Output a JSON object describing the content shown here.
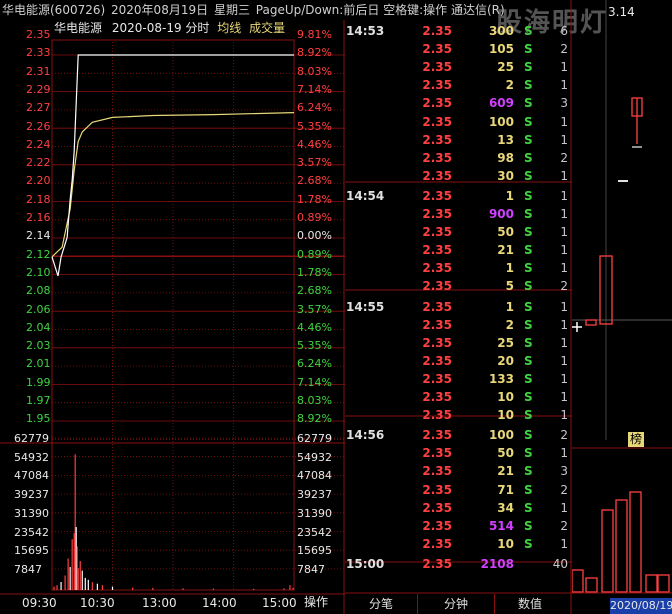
{
  "title_bar": {
    "stock": "华电能源(600726)",
    "date": "2020年08月19日",
    "weekday": "星期三",
    "hint": "PageUp/Down:前后日 空格键:操作 通达信(R)"
  },
  "watermark": "股海明灯",
  "chart_header": {
    "name": "华电能源",
    "date": "2020-08-19",
    "mode": "分时",
    "avg_label": "均线",
    "vol_label": "成交量"
  },
  "price_axis": {
    "left": [
      "2.35",
      "2.33",
      "2.31",
      "2.29",
      "2.27",
      "2.26",
      "2.24",
      "2.22",
      "2.20",
      "2.18",
      "2.16",
      "2.14",
      "2.12",
      "2.10",
      "2.08",
      "2.06",
      "2.04",
      "2.03",
      "2.01",
      "1.99",
      "1.97",
      "1.95"
    ],
    "right": [
      "9.81%",
      "8.92%",
      "8.03%",
      "7.14%",
      "6.24%",
      "5.35%",
      "4.46%",
      "3.57%",
      "2.68%",
      "1.78%",
      "0.89%",
      "0.00%",
      "0.89%",
      "1.78%",
      "2.68%",
      "3.57%",
      "4.46%",
      "5.35%",
      "6.24%",
      "7.14%",
      "8.03%",
      "8.92%"
    ]
  },
  "volume_axis": [
    "62779",
    "54932",
    "47084",
    "39237",
    "31390",
    "23542",
    "15695",
    "7847"
  ],
  "time_axis": [
    "09:30",
    "10:30",
    "13:00",
    "14:00",
    "15:00"
  ],
  "operate_label": "操作",
  "chart_data": {
    "type": "line",
    "title": "华电能源 2020-08-19 分时",
    "prev_close": 2.14,
    "ylim": [
      1.95,
      2.35
    ],
    "price_series": [
      [
        0,
        2.14
      ],
      [
        3,
        2.13
      ],
      [
        6,
        2.12
      ],
      [
        9,
        2.14
      ],
      [
        12,
        2.15
      ],
      [
        15,
        2.16
      ],
      [
        18,
        2.2
      ],
      [
        20,
        2.22
      ],
      [
        22,
        2.25
      ],
      [
        24,
        2.3
      ],
      [
        26,
        2.35
      ],
      [
        60,
        2.35
      ],
      [
        120,
        2.35
      ],
      [
        180,
        2.35
      ],
      [
        240,
        2.35
      ]
    ],
    "avg_series": [
      [
        0,
        2.14
      ],
      [
        10,
        2.15
      ],
      [
        18,
        2.19
      ],
      [
        22,
        2.23
      ],
      [
        26,
        2.26
      ],
      [
        30,
        2.27
      ],
      [
        40,
        2.28
      ],
      [
        60,
        2.285
      ],
      [
        100,
        2.287
      ],
      [
        160,
        2.288
      ],
      [
        240,
        2.29
      ]
    ],
    "volume_max": 62779,
    "volume_bars": [
      [
        2,
        1400
      ],
      [
        5,
        2000
      ],
      [
        9,
        3300
      ],
      [
        13,
        6000
      ],
      [
        16,
        13000
      ],
      [
        18,
        9500
      ],
      [
        20,
        21000
      ],
      [
        22,
        23500
      ],
      [
        23,
        56000
      ],
      [
        24,
        26000
      ],
      [
        25,
        18000
      ],
      [
        26,
        9000
      ],
      [
        28,
        12000
      ],
      [
        30,
        8000
      ],
      [
        33,
        5000
      ],
      [
        36,
        4200
      ],
      [
        40,
        3200
      ],
      [
        45,
        2600
      ],
      [
        50,
        2000
      ],
      [
        60,
        1400
      ],
      [
        80,
        1000
      ],
      [
        100,
        900
      ],
      [
        130,
        700
      ],
      [
        160,
        600
      ],
      [
        200,
        500
      ],
      [
        230,
        700
      ],
      [
        236,
        2000
      ],
      [
        239,
        900
      ]
    ]
  },
  "ticks": [
    {
      "time": "14:53",
      "price": "2.35",
      "vol": "300",
      "vc": "yellow",
      "side": "S",
      "cnt": "6"
    },
    {
      "time": "",
      "price": "2.35",
      "vol": "105",
      "vc": "yellow",
      "side": "S",
      "cnt": "2"
    },
    {
      "time": "",
      "price": "2.35",
      "vol": "25",
      "vc": "yellow",
      "side": "S",
      "cnt": "1"
    },
    {
      "time": "",
      "price": "2.35",
      "vol": "2",
      "vc": "yellow",
      "side": "S",
      "cnt": "1"
    },
    {
      "time": "",
      "price": "2.35",
      "vol": "609",
      "vc": "purple",
      "side": "S",
      "cnt": "3"
    },
    {
      "time": "",
      "price": "2.35",
      "vol": "100",
      "vc": "yellow",
      "side": "S",
      "cnt": "1"
    },
    {
      "time": "",
      "price": "2.35",
      "vol": "13",
      "vc": "yellow",
      "side": "S",
      "cnt": "1"
    },
    {
      "time": "",
      "price": "2.35",
      "vol": "98",
      "vc": "yellow",
      "side": "S",
      "cnt": "2"
    },
    {
      "time": "",
      "price": "2.35",
      "vol": "30",
      "vc": "yellow",
      "side": "S",
      "cnt": "1"
    },
    {
      "time": "14:54",
      "price": "2.35",
      "vol": "1",
      "vc": "yellow",
      "side": "S",
      "cnt": "1"
    },
    {
      "time": "",
      "price": "2.35",
      "vol": "900",
      "vc": "purple",
      "side": "S",
      "cnt": "1"
    },
    {
      "time": "",
      "price": "2.35",
      "vol": "50",
      "vc": "yellow",
      "side": "S",
      "cnt": "1"
    },
    {
      "time": "",
      "price": "2.35",
      "vol": "21",
      "vc": "yellow",
      "side": "S",
      "cnt": "1"
    },
    {
      "time": "",
      "price": "2.35",
      "vol": "1",
      "vc": "yellow",
      "side": "S",
      "cnt": "1"
    },
    {
      "time": "",
      "price": "2.35",
      "vol": "5",
      "vc": "yellow",
      "side": "S",
      "cnt": "2"
    },
    {
      "time": "14:55",
      "price": "2.35",
      "vol": "1",
      "vc": "yellow",
      "side": "S",
      "cnt": "1"
    },
    {
      "time": "",
      "price": "2.35",
      "vol": "2",
      "vc": "yellow",
      "side": "S",
      "cnt": "1"
    },
    {
      "time": "",
      "price": "2.35",
      "vol": "25",
      "vc": "yellow",
      "side": "S",
      "cnt": "1"
    },
    {
      "time": "",
      "price": "2.35",
      "vol": "20",
      "vc": "yellow",
      "side": "S",
      "cnt": "1"
    },
    {
      "time": "",
      "price": "2.35",
      "vol": "133",
      "vc": "yellow",
      "side": "S",
      "cnt": "1"
    },
    {
      "time": "",
      "price": "2.35",
      "vol": "10",
      "vc": "yellow",
      "side": "S",
      "cnt": "1"
    },
    {
      "time": "",
      "price": "2.35",
      "vol": "10",
      "vc": "yellow",
      "side": "S",
      "cnt": "1"
    },
    {
      "time": "14:56",
      "price": "2.35",
      "vol": "100",
      "vc": "yellow",
      "side": "S",
      "cnt": "2"
    },
    {
      "time": "",
      "price": "2.35",
      "vol": "50",
      "vc": "yellow",
      "side": "S",
      "cnt": "1"
    },
    {
      "time": "",
      "price": "2.35",
      "vol": "21",
      "vc": "yellow",
      "side": "S",
      "cnt": "3"
    },
    {
      "time": "",
      "price": "2.35",
      "vol": "71",
      "vc": "yellow",
      "side": "S",
      "cnt": "2"
    },
    {
      "time": "",
      "price": "2.35",
      "vol": "34",
      "vc": "yellow",
      "side": "S",
      "cnt": "1"
    },
    {
      "time": "",
      "price": "2.35",
      "vol": "514",
      "vc": "purple",
      "side": "S",
      "cnt": "2"
    },
    {
      "time": "",
      "price": "2.35",
      "vol": "10",
      "vc": "yellow",
      "side": "S",
      "cnt": "1"
    },
    {
      "time": "15:00",
      "price": "2.35",
      "vol": "2108",
      "vc": "purple",
      "side": "",
      "cnt": "40"
    }
  ],
  "kline_top_label": "3.14",
  "kline_badge": "榜",
  "kline_date": "2020/08/19",
  "tabs": [
    "分笔",
    "分钟",
    "数值"
  ],
  "colors": {
    "up": "#ff4040",
    "down": "#3fd43f",
    "avg": "#e8d87a",
    "grid": "#8a1010",
    "purple": "#d040ff"
  }
}
